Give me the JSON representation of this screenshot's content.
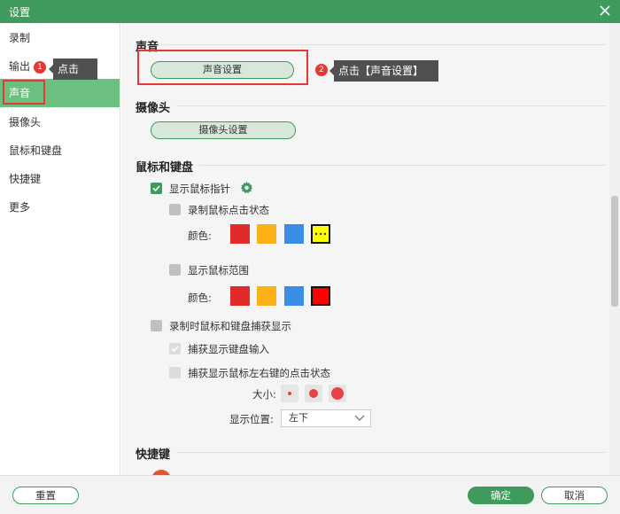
{
  "window": {
    "title": "设置"
  },
  "sidebar": {
    "items": [
      {
        "label": "录制",
        "active": false
      },
      {
        "label": "输出",
        "active": false
      },
      {
        "label": "声音",
        "active": true
      },
      {
        "label": "摄像头",
        "active": false
      },
      {
        "label": "鼠标和键盘",
        "active": false
      },
      {
        "label": "快捷键",
        "active": false
      },
      {
        "label": "更多",
        "active": false
      }
    ]
  },
  "sound": {
    "title": "声音",
    "button": "声音设置"
  },
  "camera": {
    "title": "摄像头",
    "button": "摄像头设置"
  },
  "mouse_keyboard": {
    "title": "鼠标和键盘",
    "show_pointer": {
      "label": "显示鼠标指针",
      "checked": true
    },
    "record_click": {
      "label": "录制鼠标点击状态",
      "checked": false,
      "color_label": "颜色:"
    },
    "show_range": {
      "label": "显示鼠标范围",
      "checked": false,
      "color_label": "颜色:"
    },
    "capture_display": {
      "label": "录制时鼠标和键盘捕获显示",
      "checked": false
    },
    "capture_keyboard": {
      "label": "捕获显示键盘输入",
      "checked": true,
      "disabled": true
    },
    "capture_mouse_click": {
      "label": "捕获显示鼠标左右键的点击状态",
      "checked": false,
      "disabled": true
    },
    "size_label": "大小:",
    "position_label": "显示位置:",
    "position_value": "左下"
  },
  "colors": {
    "click_swatches": [
      "#e02b2b",
      "#fbb116",
      "#3a8ee6",
      "#ffff00"
    ],
    "range_swatches": [
      "#e02b2b",
      "#fbb116",
      "#3a8ee6",
      "#ff0000"
    ],
    "accent": "#3f9b5d",
    "annotation": "#e53935"
  },
  "hotkeys": {
    "title": "快捷键"
  },
  "footer": {
    "reset": "重置",
    "ok": "确定",
    "cancel": "取消"
  },
  "annotations": {
    "step1_num": "1",
    "step1_text": "点击",
    "step2_num": "2",
    "step2_text": "点击【声音设置】"
  }
}
